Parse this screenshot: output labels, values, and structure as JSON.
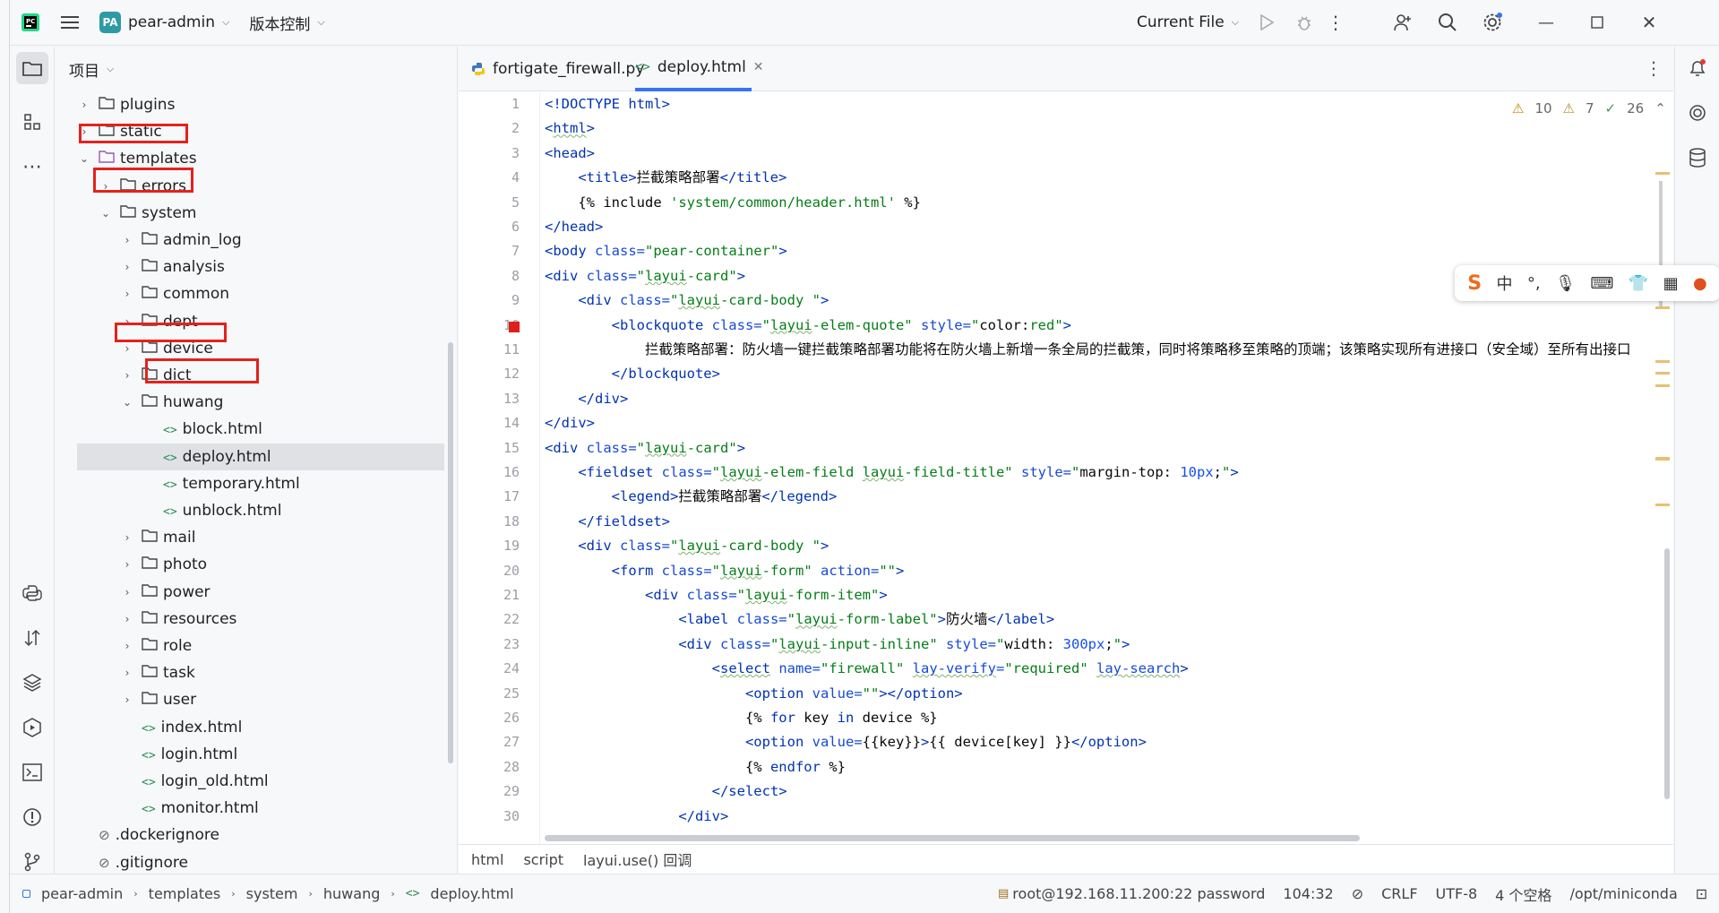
{
  "titlebar": {
    "project_badge": "PA",
    "project_name": "pear-admin",
    "vcs_label": "版本控制",
    "run_config": "Current File"
  },
  "project_panel": {
    "title": "项目",
    "items": [
      {
        "label": "plugins",
        "type": "folder",
        "expanded": false,
        "depth": 0
      },
      {
        "label": "static",
        "type": "folder",
        "expanded": false,
        "depth": 0
      },
      {
        "label": "templates",
        "type": "folder",
        "expanded": true,
        "depth": 0
      },
      {
        "label": "errors",
        "type": "folder",
        "expanded": false,
        "depth": 1
      },
      {
        "label": "system",
        "type": "folder",
        "expanded": true,
        "depth": 1
      },
      {
        "label": "admin_log",
        "type": "folder",
        "expanded": false,
        "depth": 2
      },
      {
        "label": "analysis",
        "type": "folder",
        "expanded": false,
        "depth": 2
      },
      {
        "label": "common",
        "type": "folder",
        "expanded": false,
        "depth": 2
      },
      {
        "label": "dept",
        "type": "folder",
        "expanded": false,
        "depth": 2
      },
      {
        "label": "device",
        "type": "folder",
        "expanded": false,
        "depth": 2
      },
      {
        "label": "dict",
        "type": "folder",
        "expanded": false,
        "depth": 2
      },
      {
        "label": "huwang",
        "type": "folder",
        "expanded": true,
        "depth": 2
      },
      {
        "label": "block.html",
        "type": "html",
        "depth": 3
      },
      {
        "label": "deploy.html",
        "type": "html",
        "depth": 3,
        "selected": true
      },
      {
        "label": "temporary.html",
        "type": "html",
        "depth": 3
      },
      {
        "label": "unblock.html",
        "type": "html",
        "depth": 3
      },
      {
        "label": "mail",
        "type": "folder",
        "expanded": false,
        "depth": 2
      },
      {
        "label": "photo",
        "type": "folder",
        "expanded": false,
        "depth": 2
      },
      {
        "label": "power",
        "type": "folder",
        "expanded": false,
        "depth": 2
      },
      {
        "label": "resources",
        "type": "folder",
        "expanded": false,
        "depth": 2
      },
      {
        "label": "role",
        "type": "folder",
        "expanded": false,
        "depth": 2
      },
      {
        "label": "task",
        "type": "folder",
        "expanded": false,
        "depth": 2
      },
      {
        "label": "user",
        "type": "folder",
        "expanded": false,
        "depth": 2
      },
      {
        "label": "index.html",
        "type": "html",
        "depth": 2
      },
      {
        "label": "login.html",
        "type": "html",
        "depth": 2
      },
      {
        "label": "login_old.html",
        "type": "html",
        "depth": 2
      },
      {
        "label": "monitor.html",
        "type": "html",
        "depth": 2
      },
      {
        "label": ".dockerignore",
        "type": "ignore",
        "depth": 0
      },
      {
        "label": ".gitignore",
        "type": "ignore",
        "depth": 0
      }
    ]
  },
  "tabs": [
    {
      "label": "fortigate_firewall.py",
      "active": false
    },
    {
      "label": "deploy.html",
      "active": true
    }
  ],
  "inspections": {
    "warn_a": "10",
    "warn_b": "7",
    "ok": "26"
  },
  "code_lines": [
    "1",
    "2",
    "3",
    "4",
    "5",
    "6",
    "7",
    "8",
    "9",
    "10",
    "11",
    "12",
    "13",
    "14",
    "15",
    "16",
    "17",
    "18",
    "19",
    "20",
    "21",
    "22",
    "23",
    "24",
    "25",
    "26",
    "27",
    "28",
    "29",
    "30"
  ],
  "breadcrumbs": [
    "html",
    "script",
    "layui.use() 回调"
  ],
  "status": {
    "path": [
      "pear-admin",
      "templates",
      "system",
      "huwang",
      "deploy.html"
    ],
    "remote": "root@192.168.11.200:22 password",
    "position": "104:32",
    "line_sep": "CRLF",
    "encoding": "UTF-8",
    "indent": "4 个空格",
    "interpreter": "/opt/miniconda"
  },
  "ime": {
    "lang": "中"
  }
}
